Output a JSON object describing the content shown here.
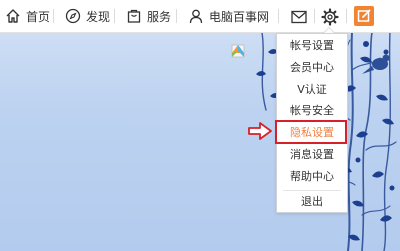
{
  "nav": {
    "home_label": "首页",
    "discover_label": "发现",
    "service_label": "服务",
    "account_label": "电脑百事网"
  },
  "icons": {
    "home": "home-icon",
    "discover": "compass-icon",
    "service": "shopping-bag-icon",
    "account": "user-icon",
    "mail": "mail-icon",
    "settings": "gear-icon",
    "edit": "edit-icon",
    "pointer": "right-arrow-icon",
    "gift": "gift-icon"
  },
  "menu": {
    "items": [
      {
        "label": "帐号设置"
      },
      {
        "label": "会员中心"
      },
      {
        "label": "V认证"
      },
      {
        "label": "帐号安全"
      },
      {
        "label": "隐私设置"
      },
      {
        "label": "消息设置"
      },
      {
        "label": "帮助中心"
      },
      {
        "label": "退出"
      }
    ]
  },
  "colors": {
    "accent_orange": "#f18432",
    "highlight_red": "#d82028",
    "background_blue": "#bcd2f0"
  }
}
